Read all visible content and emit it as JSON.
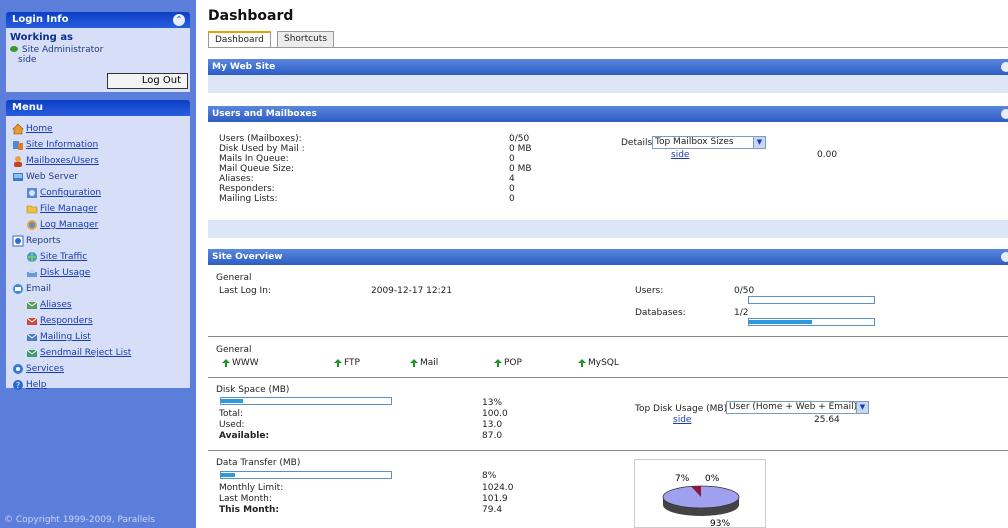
{
  "sidebar": {
    "login_title": "Login Info",
    "working_as": "Working as",
    "admin_name": "Site Administrator",
    "admin_site": "side",
    "logout_label": "Log Out",
    "menu_title": "Menu",
    "items": [
      {
        "label": "Home",
        "icon": "home-icon"
      },
      {
        "label": "Site Information",
        "icon": "site-info-icon"
      },
      {
        "label": "Mailboxes/Users",
        "icon": "users-icon"
      },
      {
        "label": "Web Server",
        "icon": "web-server-icon"
      },
      {
        "label": "Configuration",
        "icon": "configuration-icon"
      },
      {
        "label": "File Manager",
        "icon": "folder-icon"
      },
      {
        "label": "Log Manager",
        "icon": "log-icon"
      },
      {
        "label": "Reports",
        "icon": "reports-icon"
      },
      {
        "label": "Site Traffic",
        "icon": "traffic-icon"
      },
      {
        "label": "Disk Usage",
        "icon": "disk-icon"
      },
      {
        "label": "Email",
        "icon": "email-icon"
      },
      {
        "label": "Aliases",
        "icon": "aliases-icon"
      },
      {
        "label": "Responders",
        "icon": "responders-icon"
      },
      {
        "label": "Mailing List",
        "icon": "mailing-list-icon"
      },
      {
        "label": "Sendmail Reject List",
        "icon": "reject-list-icon"
      },
      {
        "label": "Services",
        "icon": "services-icon"
      },
      {
        "label": "Help",
        "icon": "help-icon"
      }
    ],
    "copyright": "© Copyright 1999-2009, Parallels"
  },
  "main": {
    "title": "Dashboard",
    "tabs": [
      "Dashboard",
      "Shortcuts"
    ],
    "my_web_site": {
      "title": "My Web Site"
    },
    "users_mailboxes": {
      "title": "Users and Mailboxes",
      "labels": [
        "Users (Mailboxes):",
        "Disk Used by Mail :",
        "Mails In Queue:",
        "Mail Queue Size:",
        "Aliases:",
        "Responders:",
        "Mailing Lists:"
      ],
      "values": [
        "0/50",
        "0 MB",
        "0",
        "0 MB",
        "4",
        "0",
        "0"
      ],
      "details_label": "Details:",
      "details_select": "Top Mailbox Sizes",
      "detail_site": "side",
      "detail_value": "0.00"
    },
    "site_overview": {
      "title": "Site Overview",
      "general_label": "General",
      "last_login_label": "Last Log In:",
      "last_login_value": "2009-12-17 12:21",
      "users_label": "Users:",
      "users_value": "0/50",
      "users_pct": 0,
      "databases_label": "Databases:",
      "databases_value": "1/2",
      "databases_pct": 50,
      "general2_label": "General",
      "services": [
        "WWW",
        "FTP",
        "Mail",
        "POP",
        "MySQL"
      ],
      "disk": {
        "title": "Disk Space (MB)",
        "percent": "13%",
        "pct_value": 13,
        "total_label": "Total:",
        "total": "100.0",
        "used_label": "Used:",
        "used": "13.0",
        "available_label": "Available:",
        "available": "87.0",
        "top_label": "Top Disk Usage (MB):",
        "top_select": "User (Home + Web + Email)",
        "top_site": "side",
        "top_value": "25.64"
      },
      "transfer": {
        "title": "Data Transfer (MB)",
        "percent": "8%",
        "pct_value": 8,
        "monthly_label": "Monthly Limit:",
        "monthly": "1024.0",
        "last_label": "Last Month:",
        "last": "101.9",
        "this_label": "This Month:",
        "this": "79.4",
        "pie_labels": [
          "7%",
          "0%",
          "93%"
        ]
      }
    }
  },
  "colors": {
    "sidebar_bg": "#5b7edb",
    "panel_bg": "#d6dff7",
    "header_blue": "#2d5dc4",
    "bar_fill": "#2d9ae0",
    "link": "#1a3cb0"
  }
}
